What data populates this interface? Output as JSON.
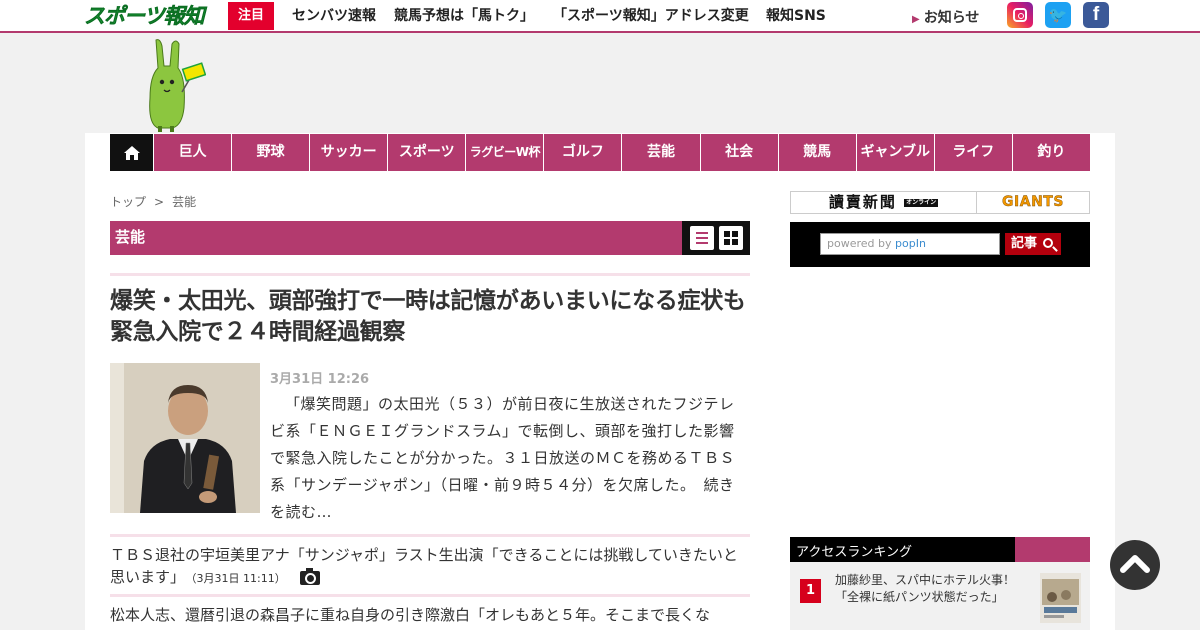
{
  "header": {
    "logo_text": "スポーツ報知",
    "hot_badge": "注目",
    "links": [
      "センバツ速報",
      "競馬予想は「馬トク」",
      "「スポーツ報知」アドレス変更",
      "報知SNS"
    ],
    "notice": "お知らせ",
    "sns": [
      {
        "name": "instagram",
        "glyph": ""
      },
      {
        "name": "twitter",
        "glyph": "🐦"
      },
      {
        "name": "facebook",
        "glyph": "f"
      }
    ]
  },
  "nav": {
    "home_icon": "home-icon",
    "categories": [
      "巨人",
      "野球",
      "サッカー",
      "スポーツ",
      "ラグビーW杯",
      "ゴルフ",
      "芸能",
      "社会",
      "競馬",
      "ギャンブル",
      "ライフ",
      "釣り"
    ]
  },
  "breadcrumb": {
    "items": [
      "トップ",
      "芸能"
    ],
    "separator": ">"
  },
  "section": {
    "title": "芸能"
  },
  "article": {
    "headline": "爆笑・太田光、頭部強打で一時は記憶があいまいになる症状も　緊急入院で２４時間経過観察",
    "published": "3月31日 12:26",
    "lead": "「爆笑問題」の太田光（５３）が前日夜に生放送されたフジテレビ系「ＥＮＧＥＩグランドスラム」で転倒し、頭部を強打した影響で緊急入院したことが分かった。３１日放送のＭＣを務めるＴＢＳ系「サンデージャポン」（日曜・前９時５４分）を欠席した。　",
    "more": "続きを読む…"
  },
  "related": [
    {
      "title": "ＴＢＳ退社の宇垣美里アナ「サンジャポ」ラスト生出演「できることには挑戦していきたいと思います」",
      "time": "（3月31日 11:11）",
      "has_photo": true
    },
    {
      "title": "松本人志、還暦引退の森昌子に重ね自身の引き際激白「オレもあと５年。そこまで長くな",
      "time": "",
      "has_photo": true
    }
  ],
  "sidebar": {
    "brand_left": "讀賣新聞",
    "brand_left_badge": "オンライン",
    "brand_right": "GIANTS",
    "search": {
      "placeholder_prefix": "powered by ",
      "placeholder_brand": "popIn",
      "button": "記事"
    },
    "ranking": {
      "title": "アクセスランキング",
      "items": [
        {
          "rank": "1",
          "title": "加藤紗里、スパ中にホテル火事！「全裸に紙パンツ状態だった」"
        }
      ]
    }
  },
  "colors": {
    "accent": "#b33a6e",
    "hot": "#e3002d",
    "logo_green": "#1fa33b"
  }
}
